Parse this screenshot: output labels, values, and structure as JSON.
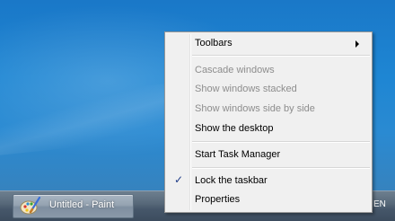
{
  "taskbar": {
    "window_button_label": "Untitled - Paint",
    "language": "EN",
    "window_icon": "paint-icon"
  },
  "context_menu": {
    "items": [
      {
        "label": "Toolbars",
        "enabled": true,
        "has_submenu": true
      },
      {
        "label": "Cascade windows",
        "enabled": false
      },
      {
        "label": "Show windows stacked",
        "enabled": false
      },
      {
        "label": "Show windows side by side",
        "enabled": false
      },
      {
        "label": "Show the desktop",
        "enabled": true
      },
      {
        "label": "Start Task Manager",
        "enabled": true
      },
      {
        "label": "Lock the taskbar",
        "enabled": true,
        "checked": true
      },
      {
        "label": "Properties",
        "enabled": true
      }
    ],
    "check_mark": "✓",
    "icons": [
      "submenu-arrow-icon",
      "checkmark-icon"
    ]
  },
  "colors": {
    "desktop": "#1e86d3",
    "taskbar": "#4e6072",
    "menu_background": "#f0f0f0",
    "disabled_text": "#8d8d8d",
    "check_mark": "#1f3c88"
  }
}
